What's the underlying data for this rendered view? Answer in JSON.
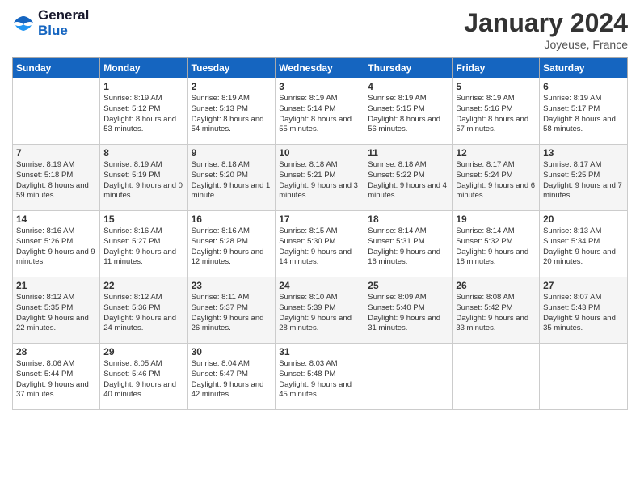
{
  "header": {
    "logo_line1": "General",
    "logo_line2": "Blue",
    "month_title": "January 2024",
    "location": "Joyeuse, France"
  },
  "days_of_week": [
    "Sunday",
    "Monday",
    "Tuesday",
    "Wednesday",
    "Thursday",
    "Friday",
    "Saturday"
  ],
  "weeks": [
    [
      {
        "day": "",
        "sunrise": "",
        "sunset": "",
        "daylight": ""
      },
      {
        "day": "1",
        "sunrise": "Sunrise: 8:19 AM",
        "sunset": "Sunset: 5:12 PM",
        "daylight": "Daylight: 8 hours and 53 minutes."
      },
      {
        "day": "2",
        "sunrise": "Sunrise: 8:19 AM",
        "sunset": "Sunset: 5:13 PM",
        "daylight": "Daylight: 8 hours and 54 minutes."
      },
      {
        "day": "3",
        "sunrise": "Sunrise: 8:19 AM",
        "sunset": "Sunset: 5:14 PM",
        "daylight": "Daylight: 8 hours and 55 minutes."
      },
      {
        "day": "4",
        "sunrise": "Sunrise: 8:19 AM",
        "sunset": "Sunset: 5:15 PM",
        "daylight": "Daylight: 8 hours and 56 minutes."
      },
      {
        "day": "5",
        "sunrise": "Sunrise: 8:19 AM",
        "sunset": "Sunset: 5:16 PM",
        "daylight": "Daylight: 8 hours and 57 minutes."
      },
      {
        "day": "6",
        "sunrise": "Sunrise: 8:19 AM",
        "sunset": "Sunset: 5:17 PM",
        "daylight": "Daylight: 8 hours and 58 minutes."
      }
    ],
    [
      {
        "day": "7",
        "sunrise": "Sunrise: 8:19 AM",
        "sunset": "Sunset: 5:18 PM",
        "daylight": "Daylight: 8 hours and 59 minutes."
      },
      {
        "day": "8",
        "sunrise": "Sunrise: 8:19 AM",
        "sunset": "Sunset: 5:19 PM",
        "daylight": "Daylight: 9 hours and 0 minutes."
      },
      {
        "day": "9",
        "sunrise": "Sunrise: 8:18 AM",
        "sunset": "Sunset: 5:20 PM",
        "daylight": "Daylight: 9 hours and 1 minute."
      },
      {
        "day": "10",
        "sunrise": "Sunrise: 8:18 AM",
        "sunset": "Sunset: 5:21 PM",
        "daylight": "Daylight: 9 hours and 3 minutes."
      },
      {
        "day": "11",
        "sunrise": "Sunrise: 8:18 AM",
        "sunset": "Sunset: 5:22 PM",
        "daylight": "Daylight: 9 hours and 4 minutes."
      },
      {
        "day": "12",
        "sunrise": "Sunrise: 8:17 AM",
        "sunset": "Sunset: 5:24 PM",
        "daylight": "Daylight: 9 hours and 6 minutes."
      },
      {
        "day": "13",
        "sunrise": "Sunrise: 8:17 AM",
        "sunset": "Sunset: 5:25 PM",
        "daylight": "Daylight: 9 hours and 7 minutes."
      }
    ],
    [
      {
        "day": "14",
        "sunrise": "Sunrise: 8:16 AM",
        "sunset": "Sunset: 5:26 PM",
        "daylight": "Daylight: 9 hours and 9 minutes."
      },
      {
        "day": "15",
        "sunrise": "Sunrise: 8:16 AM",
        "sunset": "Sunset: 5:27 PM",
        "daylight": "Daylight: 9 hours and 11 minutes."
      },
      {
        "day": "16",
        "sunrise": "Sunrise: 8:16 AM",
        "sunset": "Sunset: 5:28 PM",
        "daylight": "Daylight: 9 hours and 12 minutes."
      },
      {
        "day": "17",
        "sunrise": "Sunrise: 8:15 AM",
        "sunset": "Sunset: 5:30 PM",
        "daylight": "Daylight: 9 hours and 14 minutes."
      },
      {
        "day": "18",
        "sunrise": "Sunrise: 8:14 AM",
        "sunset": "Sunset: 5:31 PM",
        "daylight": "Daylight: 9 hours and 16 minutes."
      },
      {
        "day": "19",
        "sunrise": "Sunrise: 8:14 AM",
        "sunset": "Sunset: 5:32 PM",
        "daylight": "Daylight: 9 hours and 18 minutes."
      },
      {
        "day": "20",
        "sunrise": "Sunrise: 8:13 AM",
        "sunset": "Sunset: 5:34 PM",
        "daylight": "Daylight: 9 hours and 20 minutes."
      }
    ],
    [
      {
        "day": "21",
        "sunrise": "Sunrise: 8:12 AM",
        "sunset": "Sunset: 5:35 PM",
        "daylight": "Daylight: 9 hours and 22 minutes."
      },
      {
        "day": "22",
        "sunrise": "Sunrise: 8:12 AM",
        "sunset": "Sunset: 5:36 PM",
        "daylight": "Daylight: 9 hours and 24 minutes."
      },
      {
        "day": "23",
        "sunrise": "Sunrise: 8:11 AM",
        "sunset": "Sunset: 5:37 PM",
        "daylight": "Daylight: 9 hours and 26 minutes."
      },
      {
        "day": "24",
        "sunrise": "Sunrise: 8:10 AM",
        "sunset": "Sunset: 5:39 PM",
        "daylight": "Daylight: 9 hours and 28 minutes."
      },
      {
        "day": "25",
        "sunrise": "Sunrise: 8:09 AM",
        "sunset": "Sunset: 5:40 PM",
        "daylight": "Daylight: 9 hours and 31 minutes."
      },
      {
        "day": "26",
        "sunrise": "Sunrise: 8:08 AM",
        "sunset": "Sunset: 5:42 PM",
        "daylight": "Daylight: 9 hours and 33 minutes."
      },
      {
        "day": "27",
        "sunrise": "Sunrise: 8:07 AM",
        "sunset": "Sunset: 5:43 PM",
        "daylight": "Daylight: 9 hours and 35 minutes."
      }
    ],
    [
      {
        "day": "28",
        "sunrise": "Sunrise: 8:06 AM",
        "sunset": "Sunset: 5:44 PM",
        "daylight": "Daylight: 9 hours and 37 minutes."
      },
      {
        "day": "29",
        "sunrise": "Sunrise: 8:05 AM",
        "sunset": "Sunset: 5:46 PM",
        "daylight": "Daylight: 9 hours and 40 minutes."
      },
      {
        "day": "30",
        "sunrise": "Sunrise: 8:04 AM",
        "sunset": "Sunset: 5:47 PM",
        "daylight": "Daylight: 9 hours and 42 minutes."
      },
      {
        "day": "31",
        "sunrise": "Sunrise: 8:03 AM",
        "sunset": "Sunset: 5:48 PM",
        "daylight": "Daylight: 9 hours and 45 minutes."
      },
      {
        "day": "",
        "sunrise": "",
        "sunset": "",
        "daylight": ""
      },
      {
        "day": "",
        "sunrise": "",
        "sunset": "",
        "daylight": ""
      },
      {
        "day": "",
        "sunrise": "",
        "sunset": "",
        "daylight": ""
      }
    ]
  ]
}
